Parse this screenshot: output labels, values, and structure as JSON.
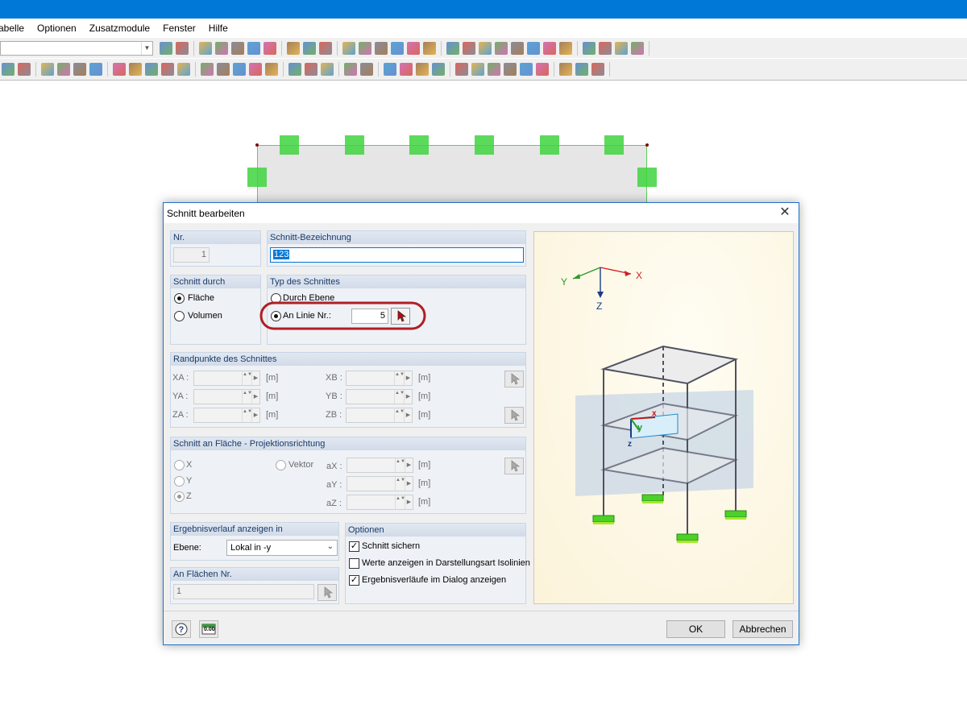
{
  "menu": [
    "abelle",
    "Optionen",
    "Zusatzmodule",
    "Fenster",
    "Hilfe"
  ],
  "dialog": {
    "title": "Schnitt bearbeiten",
    "nr": {
      "header": "Nr.",
      "value": "1"
    },
    "bezeichnung": {
      "header": "Schnitt-Bezeichnung",
      "value": "123"
    },
    "schnitt_durch": {
      "header": "Schnitt durch",
      "options": [
        "Fläche",
        "Volumen"
      ],
      "selected": "Fläche"
    },
    "typ": {
      "header": "Typ des Schnittes",
      "options": [
        "Durch Ebene",
        "An Linie Nr.:"
      ],
      "selected": "An Linie Nr.:",
      "linie_nr": "5"
    },
    "randpunkte": {
      "header": "Randpunkte des Schnittes",
      "labels_a": [
        "XA :",
        "YA :",
        "ZA :"
      ],
      "labels_b": [
        "XB :",
        "YB :",
        "ZB :"
      ],
      "unit": "[m]"
    },
    "projektion": {
      "header": "Schnitt an Fläche - Projektionsrichtung",
      "options": [
        "X",
        "Y",
        "Z"
      ],
      "selected": "Z",
      "vektor_label": "Vektor",
      "a_labels": [
        "aX :",
        "aY :",
        "aZ :"
      ],
      "unit": "[m]"
    },
    "ergebnis": {
      "header": "Ergebnisverlauf anzeigen in",
      "ebene_label": "Ebene:",
      "ebene_value": "Lokal in -y"
    },
    "an_flaechen": {
      "header": "An Flächen Nr.",
      "value": "1"
    },
    "optionen": {
      "header": "Optionen",
      "items": [
        {
          "label": "Schnitt sichern",
          "checked": true
        },
        {
          "label": "Werte anzeigen in Darstellungsart Isolinien",
          "checked": false
        },
        {
          "label": "Ergebnisverläufe im Dialog anzeigen",
          "checked": true
        }
      ]
    },
    "preview": {
      "axis_x": "X",
      "axis_y": "Y",
      "axis_z": "Z",
      "local_x": "x",
      "local_y": "y",
      "local_z": "z"
    },
    "ok_label": "OK",
    "cancel_label": "Abbrechen",
    "units_button": "0.00"
  },
  "colors": {
    "accent": "#0078d7",
    "highlight_ring": "#b01e24",
    "support_green": "#3fd43f"
  }
}
